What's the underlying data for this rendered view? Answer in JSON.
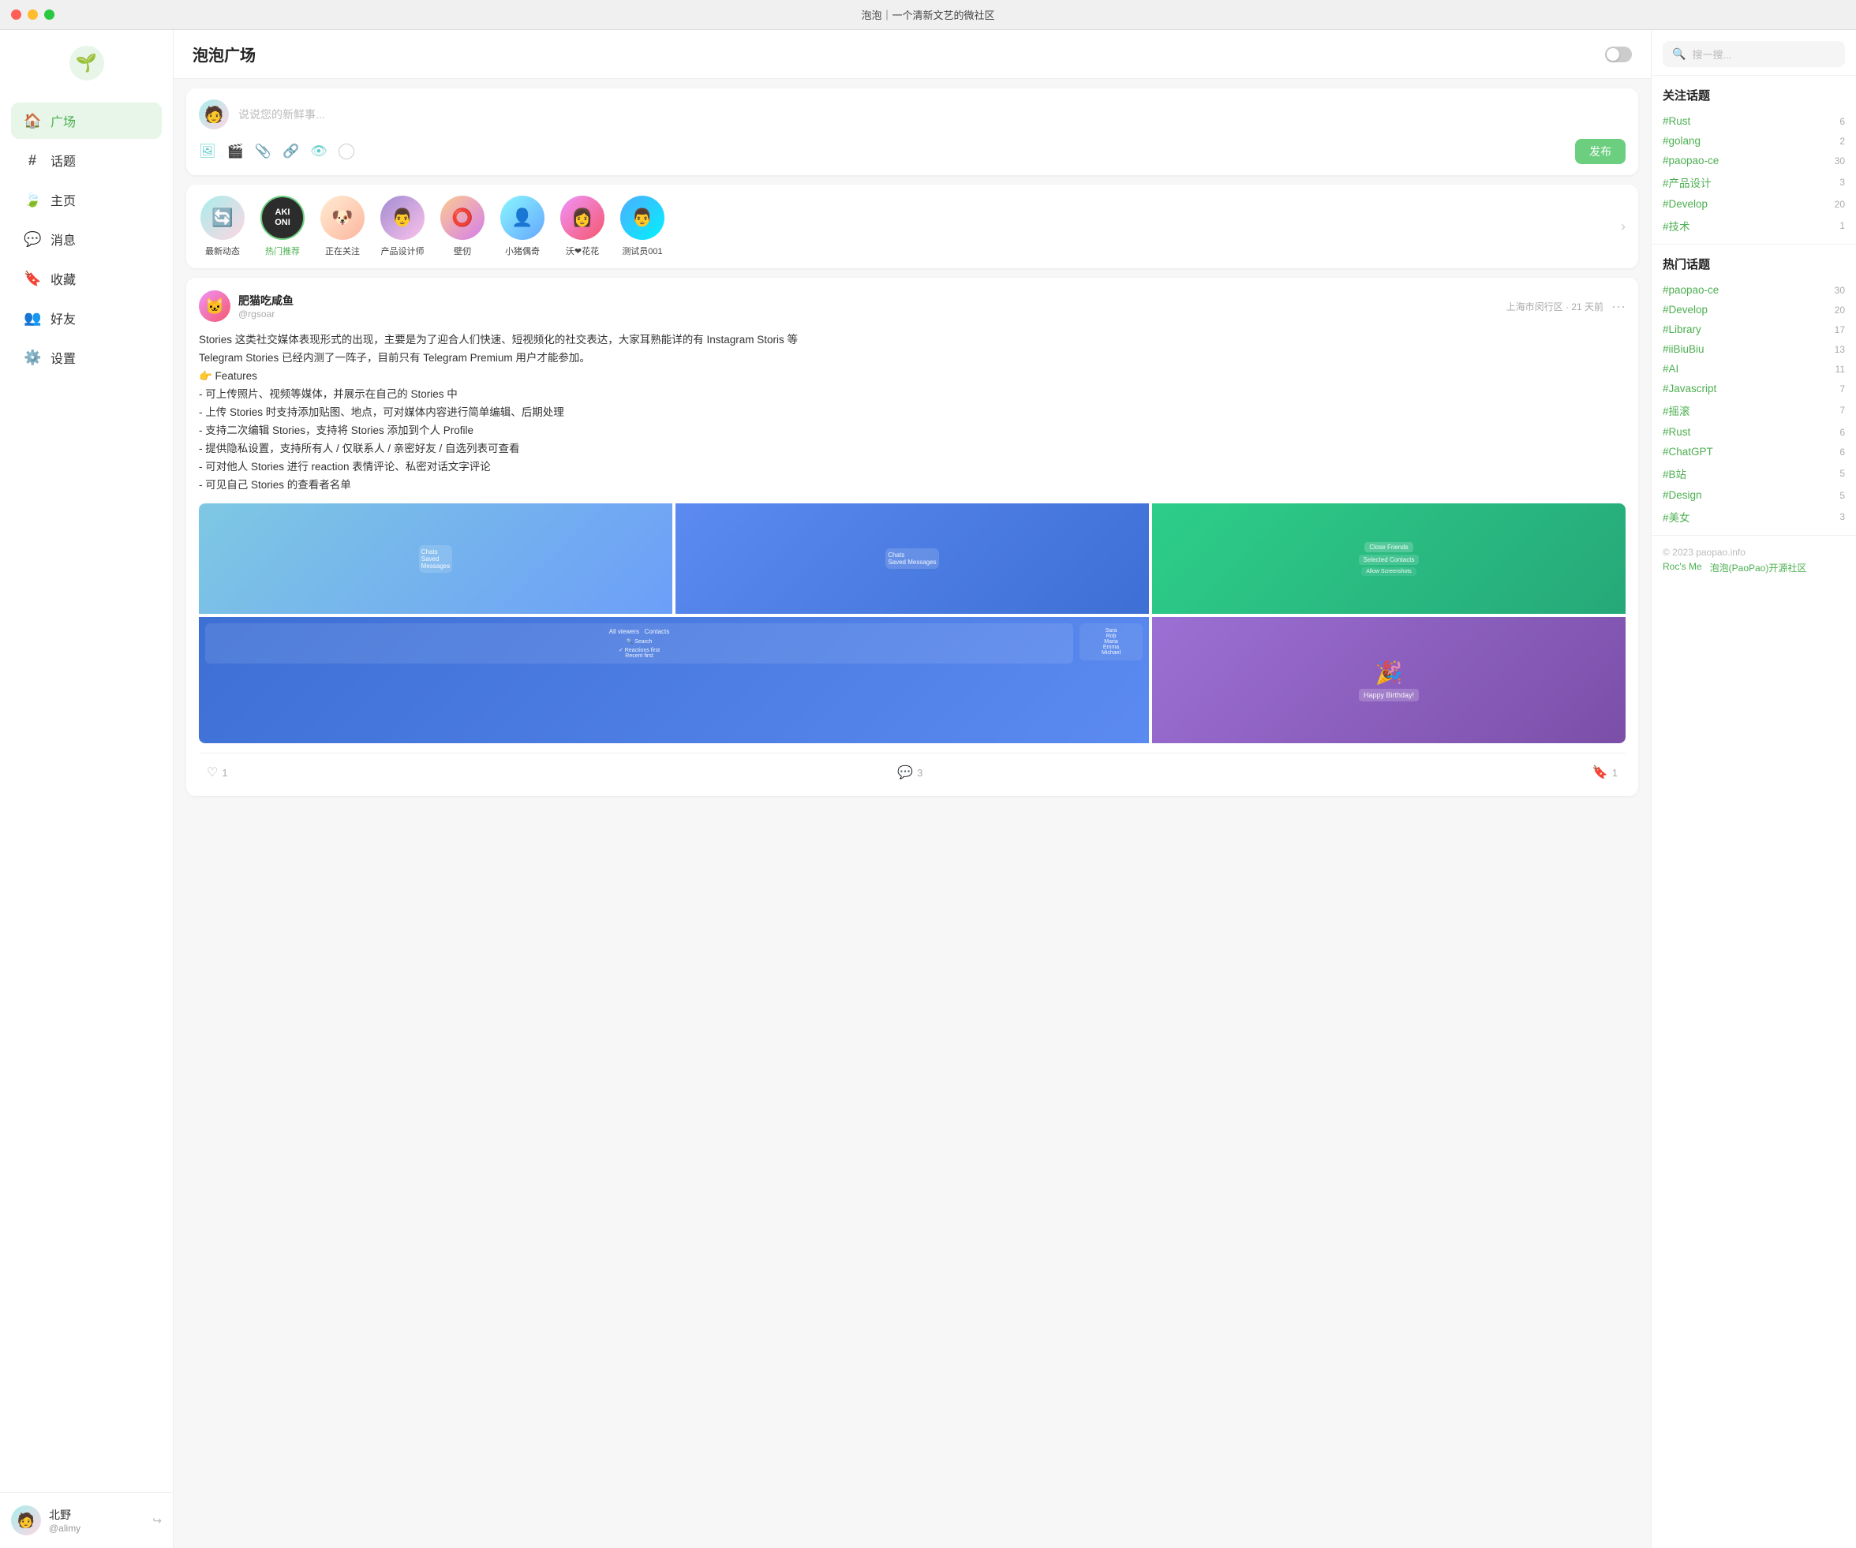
{
  "titlebar": {
    "title": "泡泡｜一个清新文艺的微社区"
  },
  "sidebar": {
    "logo_icon": "🌱",
    "nav_items": [
      {
        "id": "guangchang",
        "label": "广场",
        "icon": "🏠",
        "active": true
      },
      {
        "id": "huati",
        "label": "话题",
        "icon": "#"
      },
      {
        "id": "zhuye",
        "label": "主页",
        "icon": "🍃"
      },
      {
        "id": "xiaoxi",
        "label": "消息",
        "icon": "💬"
      },
      {
        "id": "shoucang",
        "label": "收藏",
        "icon": "🔖"
      },
      {
        "id": "haoyou",
        "label": "好友",
        "icon": "👥"
      },
      {
        "id": "shezhi",
        "label": "设置",
        "icon": "⚙️"
      }
    ],
    "footer": {
      "name": "北野",
      "handle": "@alimy"
    }
  },
  "main": {
    "header_title": "泡泡广场",
    "compose_placeholder": "说说您的新鲜事...",
    "publish_label": "发布",
    "stories": [
      {
        "label": "最新动态",
        "active": false,
        "bg": "1",
        "emoji": "🔄"
      },
      {
        "label": "热门推荐",
        "active": true,
        "bg": "2",
        "text": "AKI ONI"
      },
      {
        "label": "正在关注",
        "active": false,
        "bg": "3",
        "emoji": "🐶"
      },
      {
        "label": "产品设计师",
        "active": false,
        "bg": "4",
        "emoji": "👨"
      },
      {
        "label": "壁仞",
        "active": false,
        "bg": "5",
        "emoji": "⭕"
      },
      {
        "label": "小猪偶奇",
        "active": false,
        "bg": "6",
        "emoji": "👤"
      },
      {
        "label": "沃❤花花",
        "active": false,
        "bg": "7",
        "emoji": "👩"
      },
      {
        "label": "测试员001",
        "active": false,
        "bg": "8",
        "emoji": "👨"
      }
    ],
    "post": {
      "author": "肥猫吃咸鱼",
      "handle": "@rgsoar",
      "location_time": "上海市闵行区 · 21 天前",
      "content": "Stories 这类社交媒体表现形式的出现，主要是为了迎合人们快速、短视频化的社交表达，大家耳熟能详的有 Instagram Storis 等\nTelegram Stories 已经内测了一阵子，目前只有 Telegram Premium 用户才能参加。\n👉 Features\n- 可上传照片、视频等媒体，并展示在自己的 Stories 中\n- 上传 Stories 时支持添加贴图、地点，可对媒体内容进行简单编辑、后期处理\n- 支持二次编辑 Stories，支持将 Stories 添加到个人 Profile\n- 提供隐私设置，支持所有人 / 仅联系人 / 亲密好友 / 自选列表可查看\n- 可对他人 Stories 进行 reaction 表情评论、私密对话文字评论\n- 可见自己 Stories 的查看者名单",
      "likes": 1,
      "comments": 3,
      "bookmarks": 1
    }
  },
  "right_sidebar": {
    "search_placeholder": "搜一搜...",
    "following_topics_title": "关注话题",
    "following_topics": [
      {
        "name": "#Rust",
        "count": 6
      },
      {
        "name": "#golang",
        "count": 2
      },
      {
        "name": "#paopao-ce",
        "count": 30
      },
      {
        "name": "#产品设计",
        "count": 3
      },
      {
        "name": "#Develop",
        "count": 20
      },
      {
        "name": "#技术",
        "count": 1
      }
    ],
    "hot_topics_title": "热门话题",
    "hot_topics": [
      {
        "name": "#paopao-ce",
        "count": 30
      },
      {
        "name": "#Develop",
        "count": 20
      },
      {
        "name": "#Library",
        "count": 17
      },
      {
        "name": "#iiBiuBiu",
        "count": 13
      },
      {
        "name": "#AI",
        "count": 11
      },
      {
        "name": "#Javascript",
        "count": 7
      },
      {
        "name": "#摇滚",
        "count": 7
      },
      {
        "name": "#Rust",
        "count": 6
      },
      {
        "name": "#ChatGPT",
        "count": 6
      },
      {
        "name": "#B站",
        "count": 5
      },
      {
        "name": "#Design",
        "count": 5
      },
      {
        "name": "#美女",
        "count": 3
      }
    ],
    "footer_text": "© 2023 paopao.info",
    "footer_links": [
      "Roc's Me",
      "泡泡(PaoPao)开源社区"
    ]
  }
}
